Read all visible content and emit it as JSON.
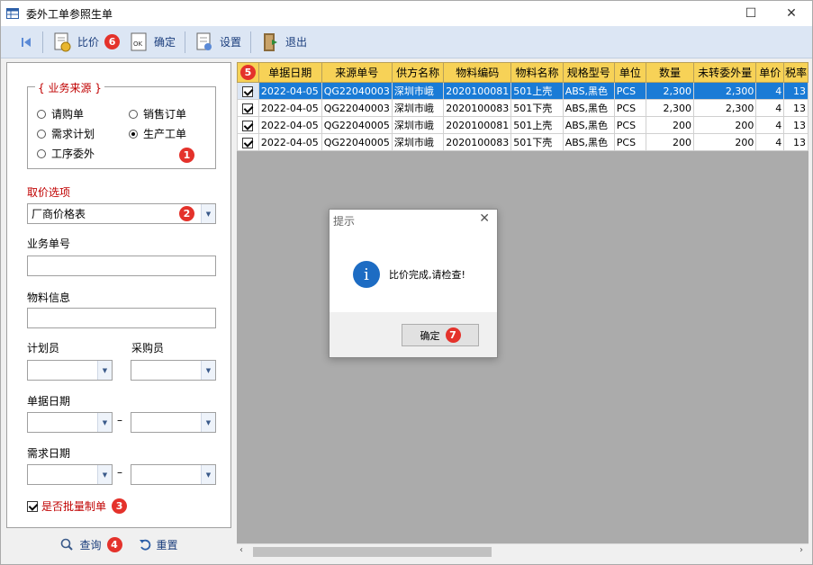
{
  "window": {
    "title": "委外工单参照生单"
  },
  "toolbar": {
    "compare_label": "比价",
    "confirm_label": "确定",
    "settings_label": "设置",
    "exit_label": "退出",
    "badge_compare": "6"
  },
  "left": {
    "source_legend": "{ 业务来源 }",
    "radios": [
      "请购单",
      "销售订单",
      "需求计划",
      "生产工单",
      "工序委外"
    ],
    "selected_radio": "生产工单",
    "badge_source": "1",
    "price_option_label": "取价选项",
    "price_option_value": "厂商价格表",
    "badge_price": "2",
    "biz_no_label": "业务单号",
    "material_label": "物料信息",
    "planner_label": "计划员",
    "buyer_label": "采购员",
    "doc_date_label": "单据日期",
    "demand_date_label": "需求日期",
    "range_sep": "–",
    "batch_label": "是否批量制单",
    "badge_batch": "3",
    "query_label": "查询",
    "badge_query": "4",
    "reset_label": "重置"
  },
  "grid": {
    "badge_header": "5",
    "columns": [
      "单据日期",
      "来源单号",
      "供方名称",
      "物料编码",
      "物料名称",
      "规格型号",
      "单位",
      "数量",
      "未转委外量",
      "单价",
      "税率"
    ],
    "rows": [
      [
        "2022-04-05",
        "QG22040003",
        "深圳市峨",
        "2020100081",
        "501上壳",
        "ABS,黑色",
        "PCS",
        "2,300",
        "2,300",
        "4",
        "13"
      ],
      [
        "2022-04-05",
        "QG22040003",
        "深圳市峨",
        "2020100083",
        "501下壳",
        "ABS,黑色",
        "PCS",
        "2,300",
        "2,300",
        "4",
        "13"
      ],
      [
        "2022-04-05",
        "QG22040005",
        "深圳市峨",
        "2020100081",
        "501上壳",
        "ABS,黑色",
        "PCS",
        "200",
        "200",
        "4",
        "13"
      ],
      [
        "2022-04-05",
        "QG22040005",
        "深圳市峨",
        "2020100083",
        "501下壳",
        "ABS,黑色",
        "PCS",
        "200",
        "200",
        "4",
        "13"
      ]
    ]
  },
  "dialog": {
    "title": "提示",
    "message": "比价完成,请检查!",
    "ok_label": "确定",
    "badge_ok": "7"
  },
  "colors": {
    "badge": "#e4322b",
    "header": "#f7d257",
    "selected": "#1a7bd6",
    "toolbar": "#dce6f4"
  }
}
